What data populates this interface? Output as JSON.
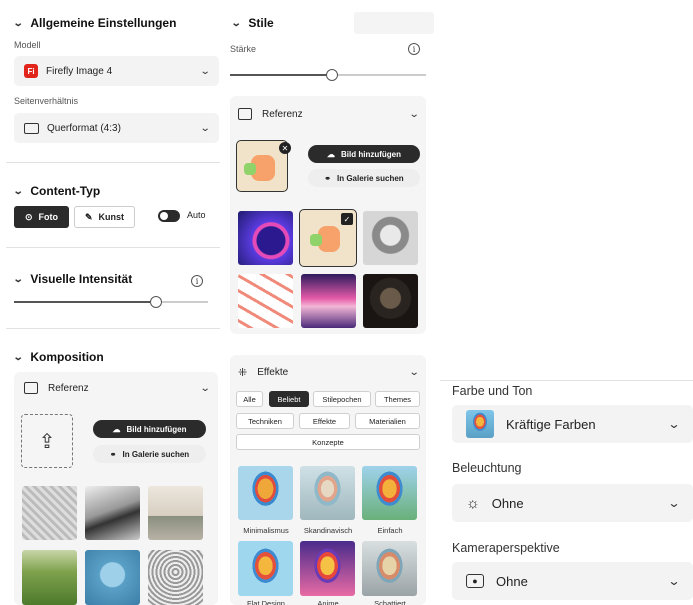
{
  "left": {
    "general": {
      "title": "Allgemeine Einstellungen",
      "model_label": "Modell",
      "model_value": "Firefly Image 4",
      "model_badge": "Fi",
      "ratio_label": "Seitenverhältnis",
      "ratio_value": "Querformat (4:3)"
    },
    "content_type": {
      "title": "Content-Typ",
      "photo": "Foto",
      "art": "Kunst",
      "auto": "Auto",
      "selected": "Foto",
      "auto_on": true
    },
    "intensity": {
      "title": "Visuelle Intensität",
      "info": "i",
      "level": 0.73
    },
    "composition": {
      "title": "Komposition",
      "ref_label": "Referenz",
      "add_image": "Bild hinzufügen",
      "gallery": "In Galerie suchen"
    }
  },
  "middle": {
    "styles": {
      "title": "Stile",
      "strength_label": "Stärke",
      "info": "i",
      "level": 0.49,
      "ref_label": "Referenz",
      "add_image": "Bild hinzufügen",
      "gallery": "In Galerie suchen"
    },
    "effects": {
      "title": "Effekte",
      "tabs": [
        "Alle",
        "Beliebt",
        "Stilepochen",
        "Themes",
        "Techniken",
        "Effekte",
        "Materialien",
        "Konzepte"
      ],
      "selected_tab": "Beliebt",
      "thumb_labels": [
        "Minimalismus",
        "Skandinavisch",
        "Einfach",
        "Flat Design",
        "Anime",
        "Schattiert"
      ]
    }
  },
  "right": {
    "color_tone": {
      "label": "Farbe und Ton",
      "value": "Kräftige Farben"
    },
    "lighting": {
      "label": "Beleuchtung",
      "value": "Ohne"
    },
    "camera": {
      "label": "Kameraperspektive",
      "value": "Ohne"
    }
  },
  "colors": {
    "accent_red": "#e1251b",
    "dark": "#2b2b2b",
    "panel": "#f3f3f3"
  }
}
